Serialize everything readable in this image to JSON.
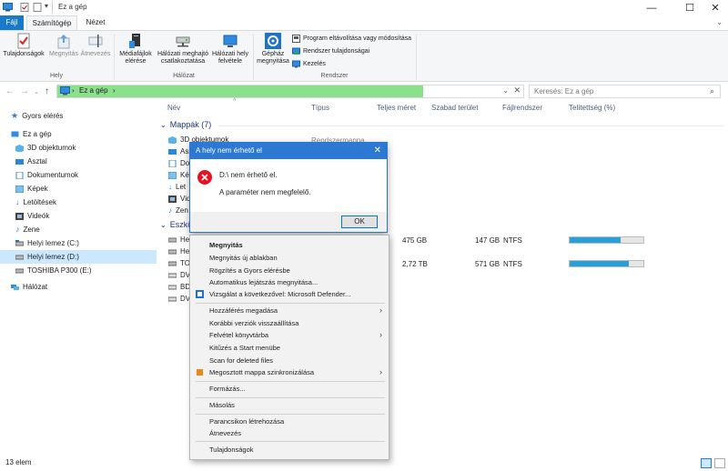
{
  "window": {
    "title": "Ez a gép",
    "controls": {
      "minimize": "—",
      "maximize": "☐",
      "close": "✕"
    }
  },
  "ribbon_tabs": [
    "Fájl",
    "Számítógép",
    "Nézet"
  ],
  "ribbon": {
    "hely": {
      "label": "Hely",
      "buttons": [
        "Tulajdonságok",
        "Megnyitás",
        "Átnevezés"
      ]
    },
    "halozat": {
      "label": "Hálózat",
      "media": [
        "Médiafájlok",
        "elérése"
      ],
      "mapdrive": [
        "Hálózati meghajtó",
        "csatlakoztatása"
      ],
      "netloc": [
        "Hálózati hely",
        "felvétele"
      ]
    },
    "rendszer": {
      "label": "Rendszer",
      "settings": [
        "Gépház",
        "megnyitása"
      ],
      "items": [
        "Program eltávolítása vagy módosítása",
        "Rendszer tulajdonságai",
        "Kezelés"
      ]
    }
  },
  "address": {
    "path": "Ez a gép",
    "search_placeholder": "Keresés: Ez a gép"
  },
  "nav": [
    {
      "label": "Gyors elérés"
    },
    {
      "label": "Ez a gép"
    },
    {
      "label": "3D objektumok"
    },
    {
      "label": "Asztal"
    },
    {
      "label": "Dokumentumok"
    },
    {
      "label": "Képek"
    },
    {
      "label": "Letöltések"
    },
    {
      "label": "Videók"
    },
    {
      "label": "Zene"
    },
    {
      "label": "Helyi lemez (C:)"
    },
    {
      "label": "Helyi lemez (D:)"
    },
    {
      "label": "TOSHIBA P300 (E:)"
    },
    {
      "label": "Hálózat"
    }
  ],
  "columns": [
    "Név",
    "Típus",
    "Teljes méret",
    "Szabad terület",
    "Fájlrendszer",
    "Telítettség (%)"
  ],
  "groups": {
    "folders": "Mappák (7)",
    "devices": "Eszközök"
  },
  "folders": [
    {
      "name": "3D objektumok",
      "type": "Rendszermappa"
    },
    {
      "name": "Asz"
    },
    {
      "name": "Do"
    },
    {
      "name": "Kép"
    },
    {
      "name": "Let"
    },
    {
      "name": "Vid"
    },
    {
      "name": "Zen"
    }
  ],
  "devices": [
    {
      "name": "Hel",
      "size": "475 GB",
      "free": "147 GB",
      "fs": "NTFS",
      "fill": 0.69
    },
    {
      "name": "Hel"
    },
    {
      "name": "TOS",
      "size": "2,72 TB",
      "free": "571 GB",
      "fs": "NTFS",
      "fill": 0.8
    },
    {
      "name": "DVI"
    },
    {
      "name": "BD-"
    },
    {
      "name": "DVI"
    }
  ],
  "status": "13 elem",
  "dialog": {
    "title": "A hely nem érhető el",
    "line1": "D:\\ nem érhető el.",
    "line2": "A paraméter nem megfelelő.",
    "ok": "OK"
  },
  "menu": {
    "items": [
      "Megnyitás",
      "Megnyitás új ablakban",
      "Rögzítés a Gyors elérésbe",
      "Automatikus lejátszás megnyitása...",
      "Vizsgálat a következővel: Microsoft Defender...",
      "Hozzáférés megadása",
      "Korábbi verziók visszaállítása",
      "Felvétel könyvtárba",
      "Kitűzés a Start menübe",
      "Scan for deleted files",
      "Megosztott mappa szinkronizálása",
      "Formázás...",
      "Másolás",
      "Parancsikon létrehozása",
      "Átnevezés",
      "Tulajdonságok"
    ]
  }
}
